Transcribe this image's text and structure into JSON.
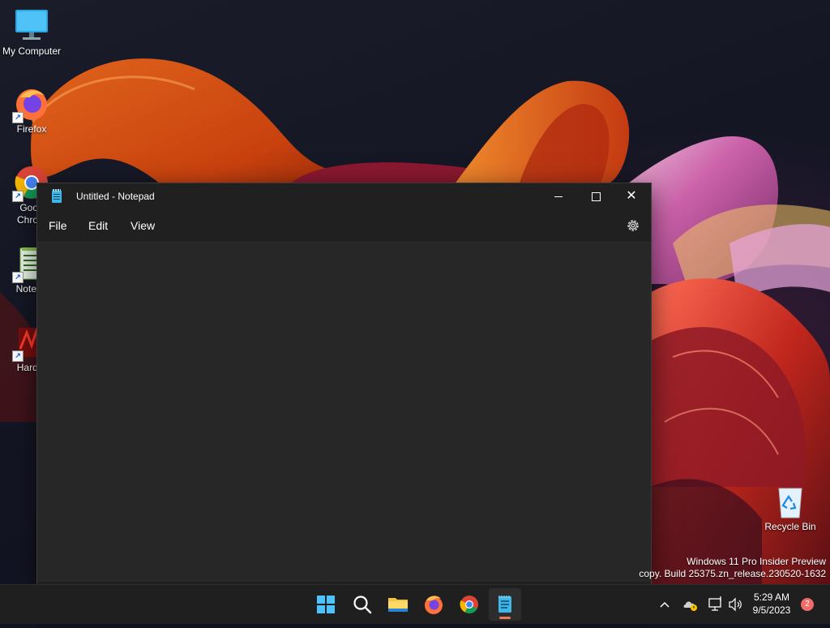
{
  "desktop": {
    "icons": [
      {
        "label": "My Computer"
      },
      {
        "label": "Firefox"
      },
      {
        "label": "Goog\nChrom"
      },
      {
        "label": "Notepa"
      },
      {
        "label": "Hard T"
      }
    ],
    "recycle_bin_label": "Recycle Bin"
  },
  "notepad": {
    "title": "Untitled - Notepad",
    "menus": {
      "file": "File",
      "edit": "Edit",
      "view": "View"
    },
    "content": ""
  },
  "watermark": {
    "line1": "Windows 11 Pro Insider Preview",
    "line2": "copy. Build 25375.zn_release.230520-1632"
  },
  "taskbar": {
    "apps": [
      {
        "icon": "windows-start-icon"
      },
      {
        "icon": "search-icon"
      },
      {
        "icon": "file-explorer-icon"
      },
      {
        "icon": "firefox-icon"
      },
      {
        "icon": "chrome-icon"
      },
      {
        "icon": "notepad-icon",
        "active": true
      }
    ],
    "clock_time": "5:29 AM",
    "clock_date": "9/5/2023",
    "notification_count": "2"
  },
  "colors": {
    "accent": "#f0785a",
    "window_bg": "#272727",
    "titlebar_bg": "#202020",
    "taskbar_bg": "#1f1f1f"
  }
}
